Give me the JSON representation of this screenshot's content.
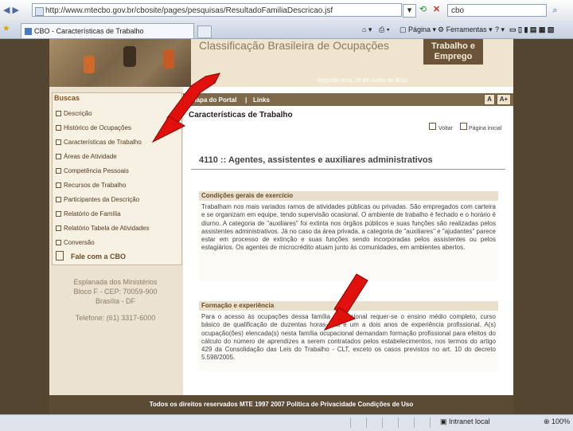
{
  "browser": {
    "url": "http://www.mtecbo.gov.br/cbosite/pages/pesquisas/ResultadoFamiliaDescricao.jsf",
    "search_value": "cbo",
    "tab_title": "CBO - Características de Trabalho",
    "commands": {
      "page": "Página",
      "tools": "Ferramentas"
    },
    "status_zone": "Intranet local",
    "zoom": "100%"
  },
  "header": {
    "site_title": "Classificação Brasileira de Ocupações",
    "brand_line1": "Trabalho e",
    "brand_line2": "Emprego",
    "date": "Segunda-feira, 28 de Junho de 2010"
  },
  "sidebar": {
    "title": "Buscas",
    "items": [
      "Descrição",
      "Histórico de Ocupações",
      "Características de Trabalho",
      "Áreas de Atividade",
      "Competência Pessoais",
      "Recursos de Trabalho",
      "Participantes da Descrição",
      "Relatório de Família",
      "Relatório Tabela de Atividades",
      "Conversão"
    ],
    "contact": "Fale com a CBO",
    "address": [
      "Esplanada dos Ministérios",
      "Bloco F - CEP: 70059-900",
      "Brasília - DF",
      "Telefone: (61) 3317-6000"
    ]
  },
  "nav": {
    "map_label": "Mapa do Portal",
    "links_label": "Links",
    "font_smaller": "A",
    "font_larger": "A+"
  },
  "main": {
    "heading": "Características de Trabalho",
    "back_label": "Voltar",
    "home_label": "Página inicial",
    "occupation_title": "4110 :: Agentes, assistentes e auxiliares administrativos",
    "sections": [
      {
        "title": "Condições gerais de exercício",
        "body": "Trabalham nos mais variados ramos de atividades públicas ou privadas. São empregados com carteira e se organizam em equipe, tendo supervisão ocasional. O ambiente de trabalho é fechado e o horário é diurno. A categoria de \"auxiliares\" foi extinta nos órgãos públicos e suas funções são realizadas pelos assistentes administrativos. Já no caso da área privada, a categoria de \"auxiliares\" e \"ajudantes\" parece estar em processo de extinção e suas funções sendo incorporadas pelos assistentes ou pelos estagiários. Os agentes de microcrédito atuam junto às comunidades, em ambientes abertos."
      },
      {
        "title": "Formação e experiência",
        "body": "Para o acesso às ocupações dessa família ocupacional requer-se o ensino médio completo, curso básico de qualificação de duzentas horas-aula e um a dois anos de experiência profissional. A(s) ocupação(ões) elencada(s) nesta família ocupacional demandam formação profissional para efeitos do cálculo do número de aprendizes a serem contratados pelos estabelecimentos, nos termos do artigo 429 da Consolidação das Leis do Trabalho - CLT, exceto os casos previstos no art. 10 do decreto 5.598/2005."
      }
    ]
  },
  "footer": {
    "text": "Todos os direitos reservados MTE 1997 2007   Política de Privacidade   Condições de Uso"
  },
  "colors": {
    "page_bg": "#53452f",
    "navbar": "#7d6a4b",
    "arrow": "#e0110d"
  }
}
